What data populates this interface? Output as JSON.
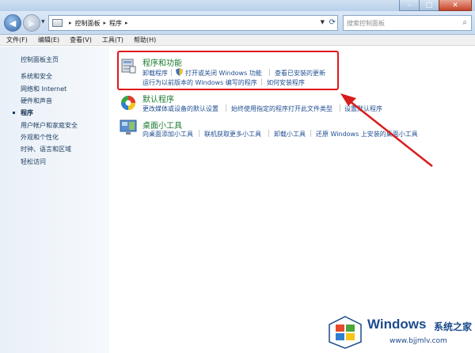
{
  "window": {
    "minimize_glyph": "–",
    "maximize_glyph": "□",
    "close_glyph": "✕"
  },
  "address_bar": {
    "breadcrumbs": [
      "控制面板",
      "程序"
    ],
    "search_placeholder": "搜索控制面板"
  },
  "menu": [
    "文件(F)",
    "编辑(E)",
    "查看(V)",
    "工具(T)",
    "帮助(H)"
  ],
  "sidebar": {
    "items": [
      {
        "label": "控制面板主页",
        "current": false
      },
      {
        "label": "系统和安全",
        "current": false
      },
      {
        "label": "网络和 Internet",
        "current": false
      },
      {
        "label": "硬件和声音",
        "current": false
      },
      {
        "label": "程序",
        "current": true
      },
      {
        "label": "用户帐户和家庭安全",
        "current": false
      },
      {
        "label": "外观和个性化",
        "current": false
      },
      {
        "label": "时钟、语言和区域",
        "current": false
      },
      {
        "label": "轻松访问",
        "current": false
      }
    ]
  },
  "sections": [
    {
      "title": "程序和功能",
      "icon": "programs-features-icon",
      "links_row1": [
        "卸载程序",
        "打开或关闭 Windows 功能",
        "查看已安装的更新"
      ],
      "links_row2": [
        "运行为以前版本的 Windows 编写的程序",
        "如何安装程序"
      ]
    },
    {
      "title": "默认程序",
      "icon": "default-programs-icon",
      "links_row1": [
        "更改媒体或设备的默认设置",
        "始终使用指定的程序打开此文件类型",
        "设置默认程序"
      ]
    },
    {
      "title": "桌面小工具",
      "icon": "desktop-gadgets-icon",
      "links_row1": [
        "向桌面添加小工具",
        "联机获取更多小工具",
        "卸载小工具",
        "还原 Windows 上安装的桌面小工具"
      ]
    }
  ],
  "watermark": {
    "brand": "Windows",
    "brand_cn": "系统之家",
    "url": "www.bjjmlv.com"
  },
  "colors": {
    "accent": "#1b7a2f",
    "link": "#1f4e92",
    "highlight": "#e21616"
  }
}
